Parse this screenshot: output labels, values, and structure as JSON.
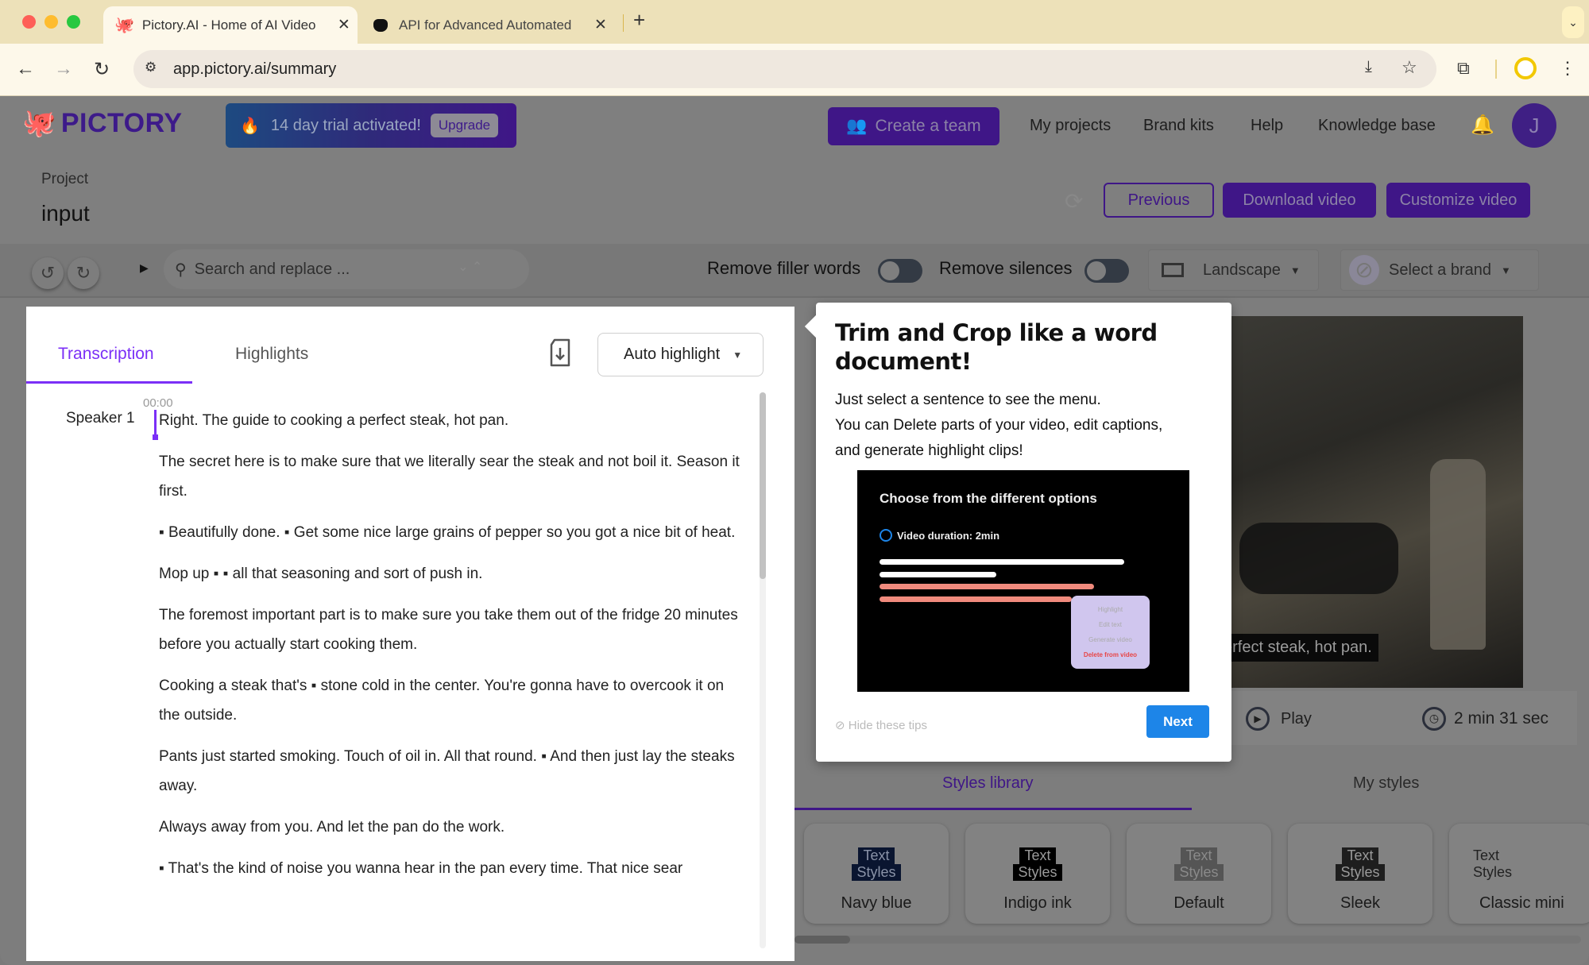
{
  "browser": {
    "tabs": [
      {
        "title": "Pictory.AI - Home of AI Video",
        "icon": "octopus-icon",
        "active": true
      },
      {
        "title": "API for Advanced Automated",
        "icon": "cat-icon",
        "active": false
      }
    ],
    "new_tab_label": "+",
    "url": "app.pictory.ai/summary"
  },
  "header": {
    "logo_text": "PICTORY",
    "trial_text": "14 day trial activated!",
    "upgrade_label": "Upgrade",
    "create_team_label": "Create a team",
    "nav": [
      "My projects",
      "Brand kits",
      "Help",
      "Knowledge base"
    ],
    "avatar_initial": "J"
  },
  "project": {
    "label": "Project",
    "name": "input",
    "previous_label": "Previous",
    "download_label": "Download video",
    "customize_label": "Customize video"
  },
  "toolbar": {
    "search_placeholder": "Search and replace ...",
    "remove_filler_label": "Remove filler words",
    "remove_filler_on": false,
    "remove_silences_label": "Remove silences",
    "remove_silences_on": false,
    "orientation": "Landscape",
    "brand": "Select a brand"
  },
  "transcript": {
    "tabs": [
      "Transcription",
      "Highlights"
    ],
    "active_tab": "Transcription",
    "auto_highlight_label": "Auto highlight",
    "speaker": "Speaker 1",
    "timestamp": "00:00",
    "paragraphs": [
      "Right. The guide to cooking a perfect steak, hot pan.",
      "The secret here is to make sure that we literally sear the steak and not boil it. Season it first.",
      "▪ Beautifully done. ▪ Get some nice large grains of pepper so you got a nice bit of heat.",
      "Mop up ▪ ▪ all that seasoning and sort of push in.",
      "The foremost important part is to make sure you take them out of the fridge 20 minutes before you actually start cooking them.",
      "Cooking a steak that's ▪ stone cold in the center. You're gonna have to overcook it on the outside.",
      "Pants just started smoking. Touch of oil in. All that round. ▪ And then just lay the steaks away.",
      "Always away from you. And let the pan do the work.",
      "▪ That's the kind of noise you wanna hear in the pan every time. That nice sear"
    ]
  },
  "video": {
    "caption": "erfect steak, hot pan.",
    "play_label": "Play",
    "duration": "2 min 31 sec"
  },
  "styles": {
    "tabs": [
      "Styles library",
      "My styles"
    ],
    "active_tab": "Styles library",
    "preview_line1": "Text",
    "preview_line2": "Styles",
    "cards": [
      {
        "name": "Navy blue",
        "bg": "#0a1530",
        "fg": "#8a93a8"
      },
      {
        "name": "Indigo ink",
        "bg": "#000000",
        "fg": "#9a9a9a"
      },
      {
        "name": "Default",
        "bg": "#555555",
        "fg": "#8a8a8a"
      },
      {
        "name": "Sleek",
        "bg": "#1e1e1e",
        "fg": "#9a9a9a"
      },
      {
        "name": "Classic mini",
        "bg": "transparent",
        "fg": "#222222"
      }
    ]
  },
  "tip": {
    "title": "Trim and Crop like a word document!",
    "body_lines": [
      "Just select a sentence to see the menu.",
      "You can Delete parts of your video, edit captions,",
      "and generate highlight clips!"
    ],
    "image_heading": "Choose from the different options",
    "image_duration": "Video duration: 2min",
    "image_menu": [
      "Highlight",
      "Edit text",
      "Generate video",
      "Delete from video"
    ],
    "hide_label": "Hide these tips",
    "next_label": "Next"
  },
  "colors": {
    "accent": "#7b2ff7",
    "brand_dark": "#3f1687",
    "next_button": "#1d85e8"
  }
}
